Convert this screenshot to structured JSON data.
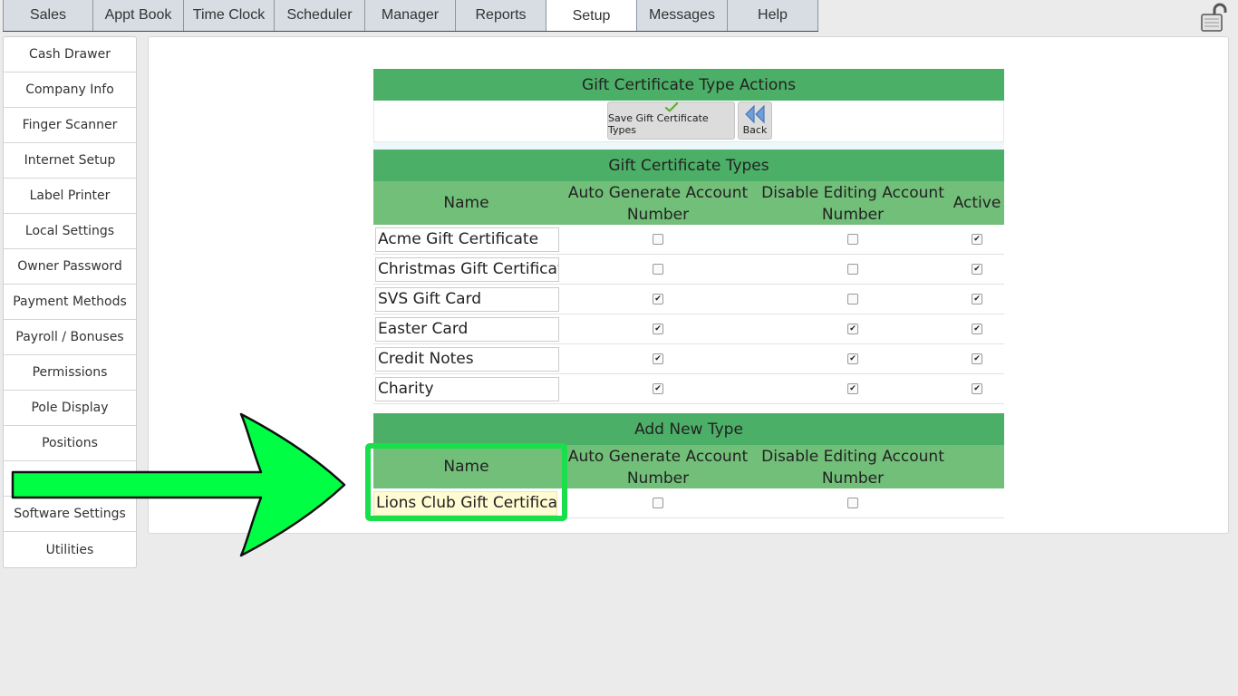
{
  "tabs": [
    "Sales",
    "Appt Book",
    "Time Clock",
    "Scheduler",
    "Manager",
    "Reports",
    "Setup",
    "Messages",
    "Help"
  ],
  "active_tab": "Setup",
  "sidebar": {
    "items": [
      "Cash Drawer",
      "Company Info",
      "Finger Scanner",
      "Internet Setup",
      "Label Printer",
      "Local Settings",
      "Owner Password",
      "Payment Methods",
      "Payroll / Bonuses",
      "Permissions",
      "Pole Display",
      "Positions",
      "",
      "Software Settings",
      "Utilities"
    ]
  },
  "actions": {
    "title": "Gift Certificate Type Actions",
    "save_label": "Save Gift Certificate Types",
    "back_label": "Back"
  },
  "types": {
    "title": "Gift Certificate Types",
    "columns": {
      "name": "Name",
      "auto": "Auto Generate Account Number",
      "disable": "Disable Editing Account Number",
      "active": "Active"
    },
    "rows": [
      {
        "name": "Acme Gift Certificate",
        "auto": false,
        "disable": false,
        "active": true
      },
      {
        "name": "Christmas Gift Certificate",
        "auto": false,
        "disable": false,
        "active": true
      },
      {
        "name": "SVS Gift Card",
        "auto": true,
        "disable": false,
        "active": true
      },
      {
        "name": "Easter Card",
        "auto": true,
        "disable": true,
        "active": true
      },
      {
        "name": "Credit Notes",
        "auto": true,
        "disable": true,
        "active": true
      },
      {
        "name": "Charity",
        "auto": true,
        "disable": true,
        "active": true
      }
    ]
  },
  "add_new": {
    "title": "Add New Type",
    "columns": {
      "name": "Name",
      "auto": "Auto Generate Account Number",
      "disable": "Disable Editing Account Number"
    },
    "name_value": "Lions Club Gift Certificate",
    "auto": false,
    "disable": false
  },
  "colors": {
    "section_header": "#4caf67",
    "column_header": "#72bf79",
    "highlight": "#19e04a",
    "arrow": "#00ff44"
  },
  "icons": {
    "save": "checkmark-icon",
    "back": "double-left-arrow-icon",
    "lock": "unlocked-padlock-icon"
  }
}
